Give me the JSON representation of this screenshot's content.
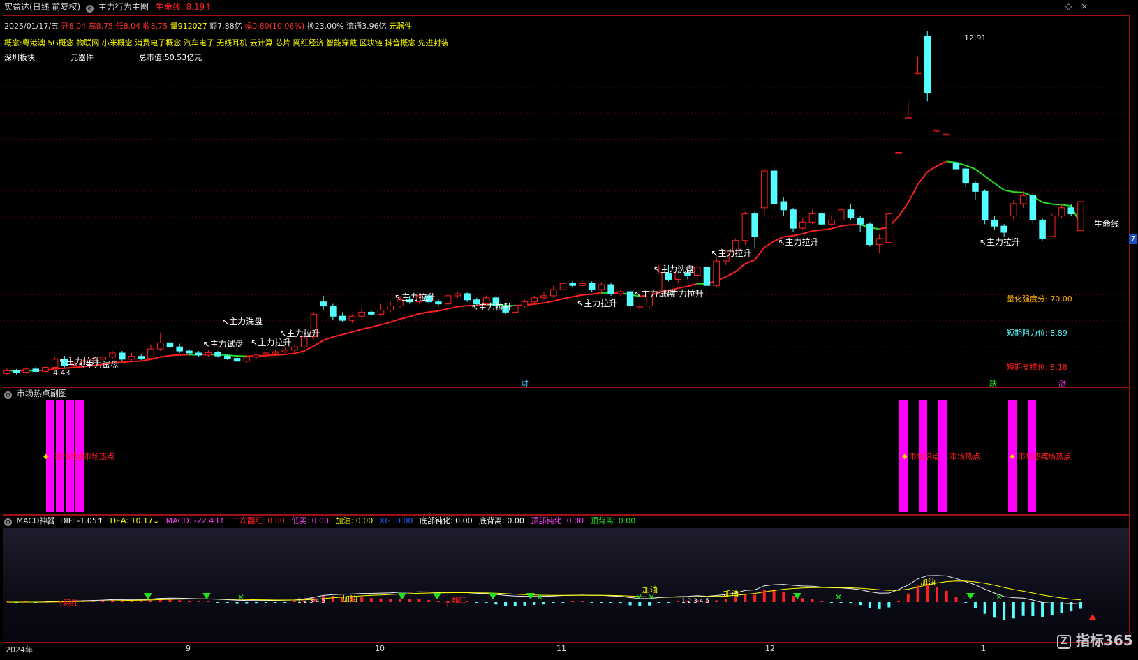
{
  "header": {
    "stock_title": "实益达(日线 前复权)",
    "indicator_title": "主力行为主图",
    "lifeline_label": "生命线: 8.19↑",
    "scroll_icon": "chevron-up-down-icon",
    "info_line": {
      "date": "2025/01/17/五",
      "open": "开8.04",
      "high": "高8.75",
      "low": "低8.04",
      "close": "收8.75",
      "volume": "量912027",
      "amount": "额7.88亿",
      "change": "幅0.80(10.06%)",
      "turnover": "换23.00%",
      "float": "流通3.96亿",
      "industry": "元器件"
    },
    "concepts": "概念:粤港澳 5G概念 物联网 小米概念 消费电子概念 汽车电子 无线耳机 云计算 芯片 网红经济 智能穿戴 区块链 抖音概念 先进封装",
    "board": "深圳板块",
    "sector": "元器件",
    "market_cap": "总市值:50.53亿元"
  },
  "main_chart": {
    "max_label": "12.91",
    "min_label": "4.43",
    "lifeline_end_label": "生命线",
    "score_label": "量化强度分: 70.00",
    "resistance_label": "短期阻力位: 8.89",
    "support_label": "短期支撑位: 8.18",
    "right_tab": "7",
    "event_badges": [
      "财",
      "跌",
      "涨"
    ],
    "annotations": {
      "pull": "主力拉升",
      "test": "主力试盘",
      "wash": "主力洗盘"
    }
  },
  "hotspot_panel": {
    "title": "市场热点副图",
    "label": "市场热点"
  },
  "macd_panel": {
    "title": "MACD神器",
    "dif": "DIF: -1.05↑",
    "dea": "DEA: 10.17↓",
    "macd": "MACD: -22.43↑",
    "second_red": "二次翻红: 0.00",
    "low_buy": "低买: 0.00",
    "refuel": "加油: 0.00",
    "blue_item": "XG: 0.00",
    "bottom_blunt": "底部钝化: 0.00",
    "bottom_div": "底背离: 0.00",
    "top_blunt": "顶部钝化: 0.00",
    "top_div": "顶背离: 0.00",
    "refuel_mark": "加油",
    "red_mark": "翻红",
    "numbers": "1 2 3 4 5"
  },
  "time_axis": [
    "2024年",
    "9",
    "10",
    "11",
    "12",
    "1"
  ],
  "watermark": "指标365",
  "colors": {
    "up": "#ff2020",
    "down": "#54ffff",
    "lifeline_up": "#ff2020",
    "lifeline_down": "#20e020",
    "hot": "#ff00ff",
    "frame": "#a01010",
    "yellow": "#ffff00"
  },
  "chart_data": {
    "type": "candlestick",
    "title": "",
    "candles": [
      {
        "o": 4.55,
        "c": 4.62,
        "h": 4.68,
        "l": 4.5
      },
      {
        "o": 4.62,
        "c": 4.58,
        "h": 4.66,
        "l": 4.52
      },
      {
        "o": 4.58,
        "c": 4.66,
        "h": 4.7,
        "l": 4.55
      },
      {
        "o": 4.66,
        "c": 4.6,
        "h": 4.72,
        "l": 4.56
      },
      {
        "o": 4.6,
        "c": 4.7,
        "h": 4.74,
        "l": 4.57
      },
      {
        "o": 4.7,
        "c": 4.9,
        "h": 4.95,
        "l": 4.66
      },
      {
        "o": 4.9,
        "c": 4.75,
        "h": 4.98,
        "l": 4.7
      },
      {
        "o": 4.75,
        "c": 4.8,
        "h": 4.85,
        "l": 4.7
      },
      {
        "o": 4.8,
        "c": 4.86,
        "h": 4.9,
        "l": 4.76
      },
      {
        "o": 4.86,
        "c": 4.9,
        "h": 4.95,
        "l": 4.82
      },
      {
        "o": 4.9,
        "c": 4.95,
        "h": 5.0,
        "l": 4.86
      },
      {
        "o": 4.95,
        "c": 5.05,
        "h": 5.1,
        "l": 4.9
      },
      {
        "o": 5.05,
        "c": 4.9,
        "h": 5.1,
        "l": 4.85
      },
      {
        "o": 4.9,
        "c": 4.97,
        "h": 5.05,
        "l": 4.86
      },
      {
        "o": 4.97,
        "c": 4.92,
        "h": 5.02,
        "l": 4.88
      },
      {
        "o": 4.92,
        "c": 5.15,
        "h": 5.25,
        "l": 4.9
      },
      {
        "o": 5.15,
        "c": 5.3,
        "h": 5.55,
        "l": 5.1
      },
      {
        "o": 5.3,
        "c": 5.2,
        "h": 5.4,
        "l": 5.15
      },
      {
        "o": 5.2,
        "c": 5.1,
        "h": 5.28,
        "l": 5.05
      },
      {
        "o": 5.1,
        "c": 5.05,
        "h": 5.15,
        "l": 5.0
      },
      {
        "o": 5.05,
        "c": 5.0,
        "h": 5.1,
        "l": 4.96
      },
      {
        "o": 5.0,
        "c": 5.06,
        "h": 5.12,
        "l": 4.96
      },
      {
        "o": 5.06,
        "c": 4.98,
        "h": 5.1,
        "l": 4.94
      },
      {
        "o": 4.98,
        "c": 4.92,
        "h": 5.02,
        "l": 4.88
      },
      {
        "o": 4.92,
        "c": 4.85,
        "h": 4.96,
        "l": 4.8
      },
      {
        "o": 4.85,
        "c": 4.95,
        "h": 5.0,
        "l": 4.82
      },
      {
        "o": 4.95,
        "c": 5.0,
        "h": 5.04,
        "l": 4.9
      },
      {
        "o": 5.0,
        "c": 5.05,
        "h": 5.08,
        "l": 4.96
      },
      {
        "o": 5.05,
        "c": 5.08,
        "h": 5.12,
        "l": 5.0
      },
      {
        "o": 5.08,
        "c": 5.12,
        "h": 5.18,
        "l": 5.04
      },
      {
        "o": 5.12,
        "c": 5.2,
        "h": 5.26,
        "l": 5.08
      },
      {
        "o": 5.2,
        "c": 5.45,
        "h": 5.55,
        "l": 5.15
      },
      {
        "o": 5.45,
        "c": 6.0,
        "h": 6.05,
        "l": 5.4
      },
      {
        "o": 6.3,
        "c": 6.2,
        "h": 6.45,
        "l": 6.1
      },
      {
        "o": 6.2,
        "c": 5.95,
        "h": 6.25,
        "l": 5.85
      },
      {
        "o": 5.95,
        "c": 5.85,
        "h": 6.05,
        "l": 5.8
      },
      {
        "o": 5.85,
        "c": 5.95,
        "h": 6.0,
        "l": 5.78
      },
      {
        "o": 5.95,
        "c": 6.05,
        "h": 6.15,
        "l": 5.9
      },
      {
        "o": 6.05,
        "c": 6.0,
        "h": 6.1,
        "l": 5.95
      },
      {
        "o": 6.0,
        "c": 6.1,
        "h": 6.25,
        "l": 5.96
      },
      {
        "o": 6.1,
        "c": 6.2,
        "h": 6.3,
        "l": 6.05
      },
      {
        "o": 6.2,
        "c": 6.35,
        "h": 6.45,
        "l": 6.15
      },
      {
        "o": 6.35,
        "c": 6.3,
        "h": 6.45,
        "l": 6.25
      },
      {
        "o": 6.3,
        "c": 6.45,
        "h": 6.5,
        "l": 6.25
      },
      {
        "o": 6.45,
        "c": 6.3,
        "h": 6.5,
        "l": 6.25
      },
      {
        "o": 6.3,
        "c": 6.25,
        "h": 6.38,
        "l": 6.2
      },
      {
        "o": 6.25,
        "c": 6.45,
        "h": 6.5,
        "l": 6.2
      },
      {
        "o": 6.45,
        "c": 6.5,
        "h": 6.55,
        "l": 6.4
      },
      {
        "o": 6.5,
        "c": 6.35,
        "h": 6.55,
        "l": 6.3
      },
      {
        "o": 6.35,
        "c": 6.25,
        "h": 6.4,
        "l": 6.2
      },
      {
        "o": 6.25,
        "c": 6.4,
        "h": 6.45,
        "l": 6.2
      },
      {
        "o": 6.4,
        "c": 6.2,
        "h": 6.45,
        "l": 6.15
      },
      {
        "o": 6.2,
        "c": 6.05,
        "h": 6.25,
        "l": 6.0
      },
      {
        "o": 6.05,
        "c": 6.2,
        "h": 6.25,
        "l": 6.0
      },
      {
        "o": 6.2,
        "c": 6.3,
        "h": 6.35,
        "l": 6.15
      },
      {
        "o": 6.3,
        "c": 6.4,
        "h": 6.45,
        "l": 6.25
      },
      {
        "o": 6.4,
        "c": 6.45,
        "h": 6.55,
        "l": 6.35
      },
      {
        "o": 6.45,
        "c": 6.6,
        "h": 6.7,
        "l": 6.4
      },
      {
        "o": 6.6,
        "c": 6.75,
        "h": 6.8,
        "l": 6.55
      },
      {
        "o": 6.75,
        "c": 6.7,
        "h": 6.8,
        "l": 6.65
      },
      {
        "o": 6.7,
        "c": 6.75,
        "h": 6.82,
        "l": 6.65
      },
      {
        "o": 6.75,
        "c": 6.6,
        "h": 6.8,
        "l": 6.55
      },
      {
        "o": 6.6,
        "c": 6.72,
        "h": 6.78,
        "l": 6.55
      },
      {
        "o": 6.72,
        "c": 6.5,
        "h": 6.76,
        "l": 6.45
      },
      {
        "o": 6.5,
        "c": 6.55,
        "h": 6.6,
        "l": 6.45
      },
      {
        "o": 6.55,
        "c": 6.2,
        "h": 6.6,
        "l": 6.1
      },
      {
        "o": 6.2,
        "c": 6.2,
        "h": 6.25,
        "l": 6.1
      },
      {
        "o": 6.2,
        "c": 6.55,
        "h": 6.6,
        "l": 6.15
      },
      {
        "o": 6.55,
        "c": 7.0,
        "h": 7.2,
        "l": 6.5
      },
      {
        "o": 7.0,
        "c": 6.85,
        "h": 7.2,
        "l": 6.8
      },
      {
        "o": 6.85,
        "c": 7.0,
        "h": 7.05,
        "l": 6.75
      },
      {
        "o": 7.0,
        "c": 6.95,
        "h": 7.1,
        "l": 6.85
      },
      {
        "o": 6.95,
        "c": 7.15,
        "h": 7.25,
        "l": 6.9
      },
      {
        "o": 7.15,
        "c": 6.7,
        "h": 7.2,
        "l": 6.5
      },
      {
        "o": 6.7,
        "c": 7.3,
        "h": 7.4,
        "l": 6.65
      },
      {
        "o": 7.3,
        "c": 7.5,
        "h": 7.55,
        "l": 7.2
      },
      {
        "o": 7.5,
        "c": 7.8,
        "h": 7.85,
        "l": 7.45
      },
      {
        "o": 7.8,
        "c": 8.45,
        "h": 8.5,
        "l": 7.7
      },
      {
        "o": 8.45,
        "c": 7.9,
        "h": 8.5,
        "l": 7.6
      },
      {
        "o": 8.6,
        "c": 9.5,
        "h": 9.55,
        "l": 8.4
      },
      {
        "o": 9.5,
        "c": 8.7,
        "h": 9.65,
        "l": 8.5
      },
      {
        "o": 8.75,
        "c": 8.55,
        "h": 8.85,
        "l": 8.4
      },
      {
        "o": 8.55,
        "c": 8.1,
        "h": 8.6,
        "l": 8.0
      },
      {
        "o": 8.1,
        "c": 8.25,
        "h": 8.35,
        "l": 8.05
      },
      {
        "o": 8.25,
        "c": 8.45,
        "h": 8.55,
        "l": 8.2
      },
      {
        "o": 8.45,
        "c": 8.2,
        "h": 8.5,
        "l": 8.15
      },
      {
        "o": 8.2,
        "c": 8.3,
        "h": 8.4,
        "l": 8.15
      },
      {
        "o": 8.3,
        "c": 8.55,
        "h": 8.6,
        "l": 8.25
      },
      {
        "o": 8.55,
        "c": 8.35,
        "h": 8.68,
        "l": 8.3
      },
      {
        "o": 8.35,
        "c": 8.2,
        "h": 8.4,
        "l": 8.0
      },
      {
        "o": 8.2,
        "c": 7.7,
        "h": 8.25,
        "l": 7.65
      },
      {
        "o": 7.7,
        "c": 7.85,
        "h": 7.95,
        "l": 7.5
      },
      {
        "o": 7.75,
        "c": 8.45,
        "h": 8.5,
        "l": 7.7
      },
      {
        "o": 9.95,
        "c": 9.95,
        "h": 9.95,
        "l": 9.95
      },
      {
        "o": 10.8,
        "c": 10.8,
        "h": 11.2,
        "l": 10.8
      },
      {
        "o": 11.9,
        "c": 11.9,
        "h": 12.3,
        "l": 11.9
      },
      {
        "o": 12.8,
        "c": 11.4,
        "h": 12.91,
        "l": 11.2
      },
      {
        "o": 10.5,
        "c": 10.5,
        "h": 10.5,
        "l": 10.45
      },
      {
        "o": 10.4,
        "c": 10.4,
        "h": 10.4,
        "l": 10.4
      },
      {
        "o": 9.7,
        "c": 9.55,
        "h": 9.8,
        "l": 9.45
      },
      {
        "o": 9.55,
        "c": 9.2,
        "h": 9.6,
        "l": 9.1
      },
      {
        "o": 9.2,
        "c": 9.0,
        "h": 9.25,
        "l": 8.8
      },
      {
        "o": 9.0,
        "c": 8.3,
        "h": 9.05,
        "l": 8.2
      },
      {
        "o": 8.3,
        "c": 8.15,
        "h": 8.4,
        "l": 8.05
      },
      {
        "o": 8.15,
        "c": 8.0,
        "h": 8.2,
        "l": 7.9
      },
      {
        "o": 8.4,
        "c": 8.7,
        "h": 8.8,
        "l": 8.3
      },
      {
        "o": 8.7,
        "c": 8.9,
        "h": 9.0,
        "l": 8.6
      },
      {
        "o": 8.9,
        "c": 8.3,
        "h": 8.95,
        "l": 8.2
      },
      {
        "o": 8.3,
        "c": 7.85,
        "h": 8.35,
        "l": 7.8
      },
      {
        "o": 7.9,
        "c": 8.4,
        "h": 8.45,
        "l": 7.9
      },
      {
        "o": 8.4,
        "c": 8.6,
        "h": 8.7,
        "l": 8.35
      },
      {
        "o": 8.6,
        "c": 8.45,
        "h": 8.7,
        "l": 8.4
      },
      {
        "o": 8.04,
        "c": 8.75,
        "h": 8.75,
        "l": 8.04
      }
    ],
    "lifeline_end": 8.19,
    "ylim": [
      4.3,
      13.2
    ]
  }
}
